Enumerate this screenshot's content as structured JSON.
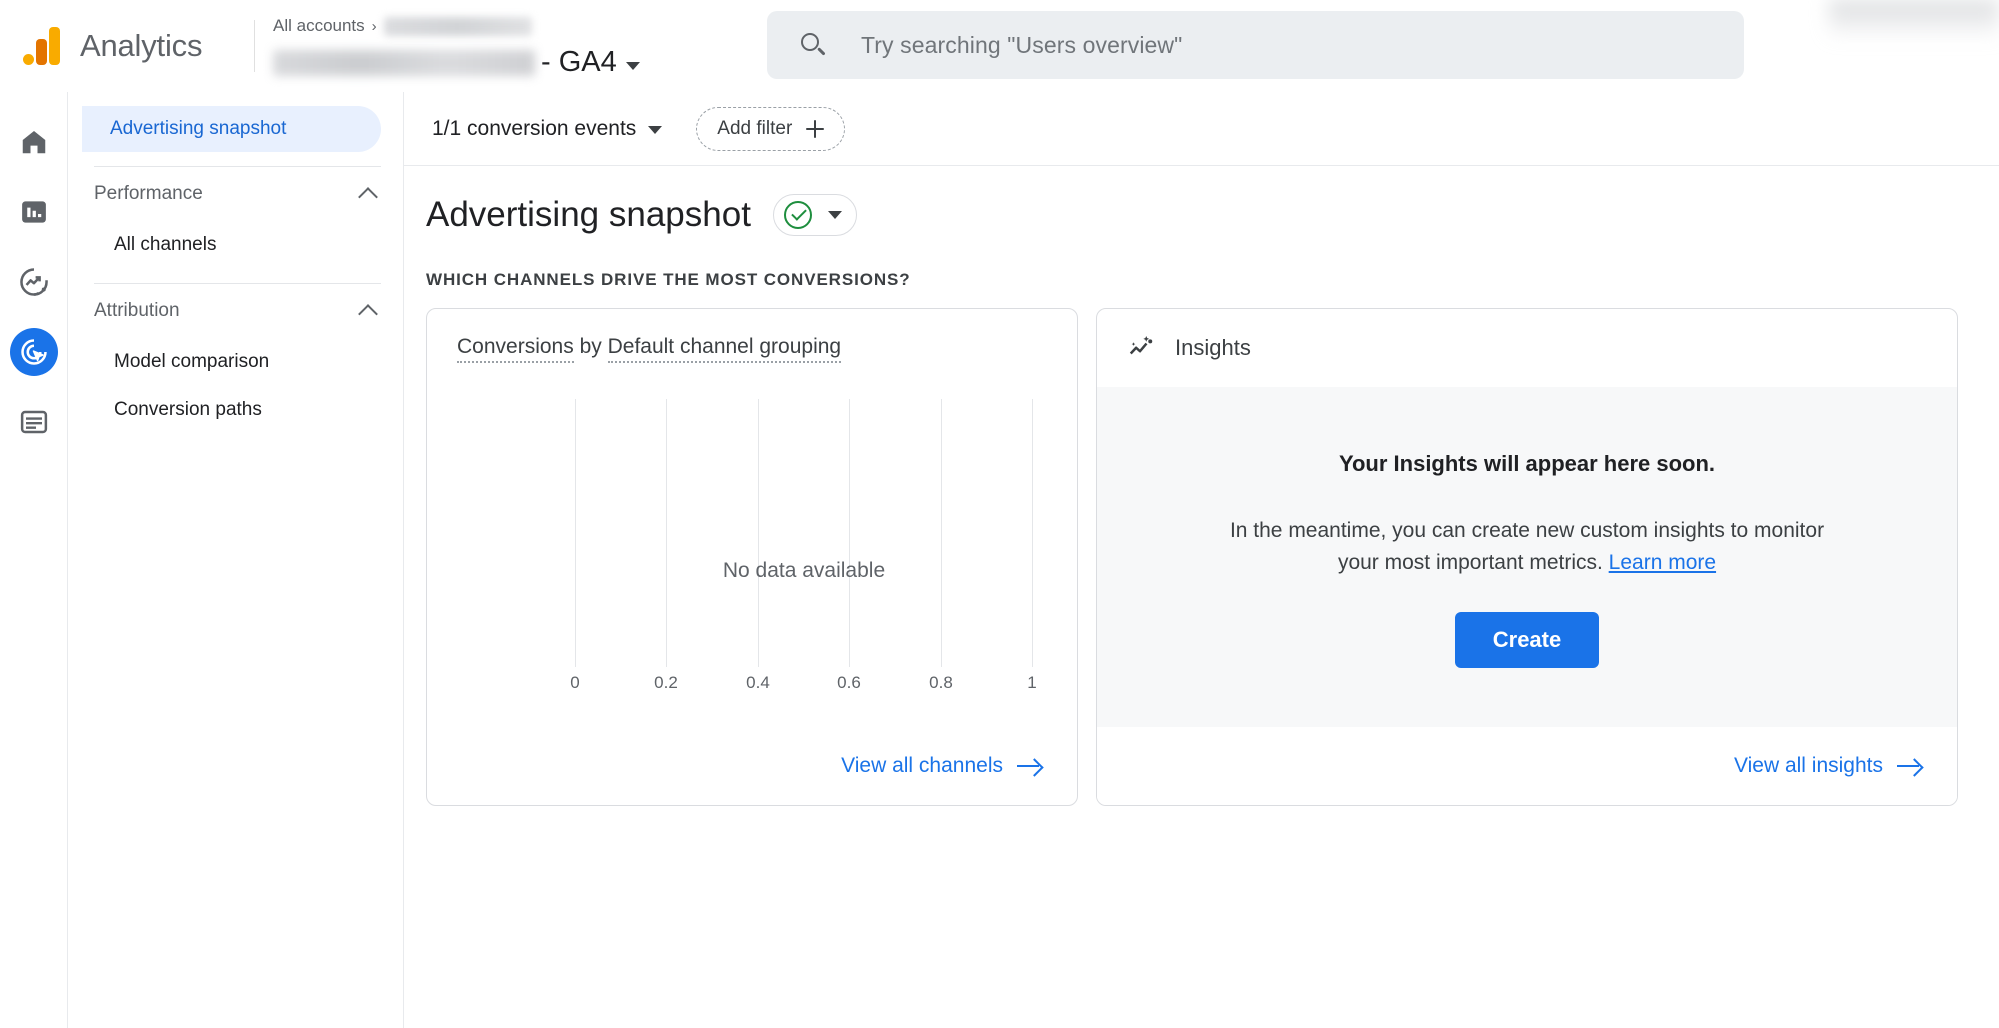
{
  "header": {
    "brand_name": "Analytics",
    "logo_icon": "google-analytics-logo",
    "breadcrumb_all_accounts": "All accounts",
    "breadcrumb_separator": "›",
    "property_suffix": "- GA4",
    "property_caret_icon": "caret-down-icon",
    "search": {
      "icon": "search-icon",
      "placeholder": "Try searching \"Users overview\"",
      "value": ""
    }
  },
  "rail": {
    "items": [
      {
        "name": "home",
        "icon": "home-icon",
        "active": false
      },
      {
        "name": "reports",
        "icon": "bar-chart-icon",
        "active": false
      },
      {
        "name": "explore",
        "icon": "explore-trend-icon",
        "active": false
      },
      {
        "name": "advertising",
        "icon": "advertising-target-cursor-icon",
        "active": true
      },
      {
        "name": "configure",
        "icon": "list-lines-icon",
        "active": false
      }
    ]
  },
  "annotation": {
    "type": "arrow-pointer",
    "color": "#1a73e8",
    "points_to": "advertising-rail-icon"
  },
  "sidebar": {
    "selected_item": "Advertising snapshot",
    "groups": [
      {
        "label": "Performance",
        "collapse_icon": "chevron-up-icon",
        "items": [
          "All channels"
        ]
      },
      {
        "label": "Attribution",
        "collapse_icon": "chevron-up-icon",
        "items": [
          "Model comparison",
          "Conversion paths"
        ]
      }
    ]
  },
  "toolbar": {
    "conversion_events_label": "1/1 conversion events",
    "conversion_events_caret": "caret-down-icon",
    "add_filter_label": "Add filter",
    "add_filter_icon": "plus-icon"
  },
  "page": {
    "title": "Advertising snapshot",
    "status_icon": "check-circle-icon",
    "status_caret": "caret-down-icon",
    "section_label": "WHICH CHANNELS DRIVE THE MOST CONVERSIONS?"
  },
  "cards": {
    "channels": {
      "title_part1": "Conversions",
      "title_middle": " by ",
      "title_part2": "Default channel grouping",
      "empty_message": "No data available",
      "footer_link": "View all channels",
      "footer_icon": "arrow-right-icon"
    },
    "insights": {
      "icon": "insights-sparkline-icon",
      "title": "Insights",
      "heading": "Your Insights will appear here soon.",
      "body_text": "In the meantime, you can create new custom insights to monitor your most important metrics. ",
      "learn_more": "Learn more",
      "create_button": "Create",
      "footer_link": "View all insights",
      "footer_icon": "arrow-right-icon"
    }
  },
  "chart_data": {
    "type": "bar",
    "title": "Conversions by Default channel grouping",
    "orientation": "horizontal",
    "categories": [],
    "values": [],
    "series": [],
    "xlabel": "",
    "ylabel": "",
    "xlim": [
      0,
      1
    ],
    "tick_labels": [
      "0",
      "0.2",
      "0.4",
      "0.6",
      "0.8",
      "1"
    ],
    "tick_values": [
      0,
      0.2,
      0.4,
      0.6,
      0.8,
      1
    ],
    "grid": true,
    "legend": false,
    "empty": true,
    "empty_message": "No data available"
  },
  "colors": {
    "accent_blue": "#1a73e8",
    "selected_bg": "#e8f0fe",
    "selected_text": "#1967d2",
    "green_status": "#1e8e3e",
    "logo_orange": "#E37400",
    "logo_yellow": "#F9AB00"
  }
}
